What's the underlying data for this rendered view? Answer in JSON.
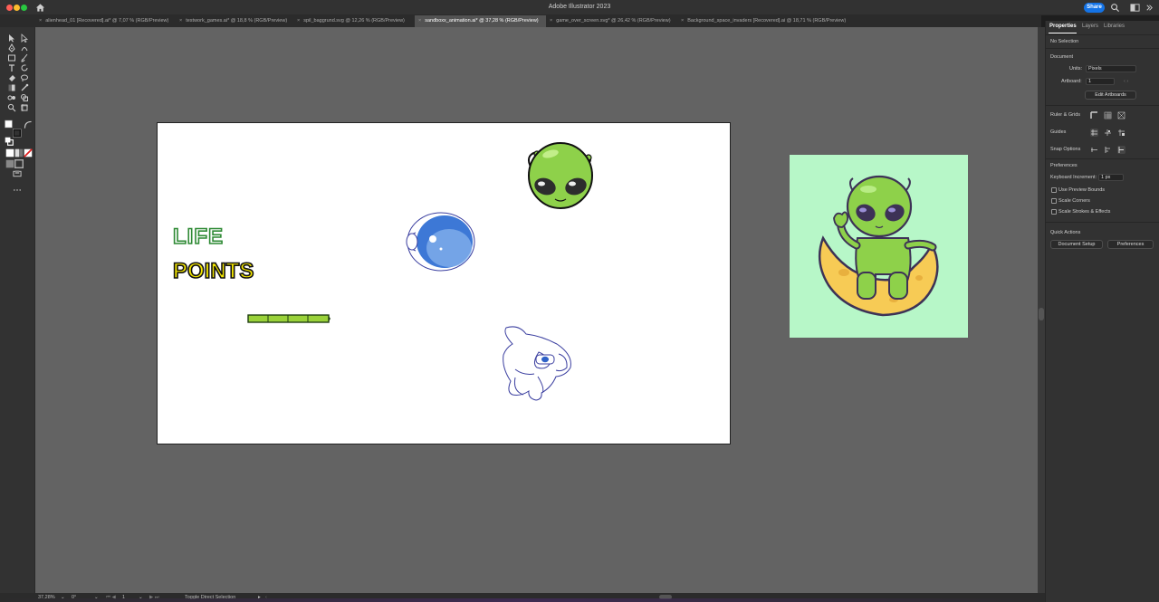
{
  "window": {
    "title": "Adobe Illustrator 2023",
    "share_label": "Share"
  },
  "tabs": [
    {
      "label": "alienhead_01 [Recovered].ai* @ 7,07 % (RGB/Preview)",
      "active": false
    },
    {
      "label": "testwork_games.ai* @ 18,8 % (RGB/Preview)",
      "active": false
    },
    {
      "label": "spil_baggrund.svg @ 12,26 % (RGB/Preview)",
      "active": false
    },
    {
      "label": "sandboxx_animation.ai* @ 37,28 % (RGB/Preview)",
      "active": true
    },
    {
      "label": "game_over_screen.svg* @ 26,42 % (RGB/Preview)",
      "active": false
    },
    {
      "label": "Background_space_invaders [Recovered].ai @ 18,71 % (RGB/Preview)",
      "active": false
    }
  ],
  "tab_close_glyph": "×",
  "artwork": {
    "life_text": "LIFE",
    "points_text": "POINTS"
  },
  "panel": {
    "tabs": [
      "Properties",
      "Layers",
      "Libraries"
    ],
    "selection": "No Selection",
    "document_heading": "Document",
    "units_label": "Units:",
    "units_value": "Pixels",
    "artboard_label": "Artboard:",
    "artboard_value": "1",
    "edit_artboards": "Edit Artboards",
    "ruler_grids": "Ruler & Grids",
    "guides": "Guides",
    "snap_options": "Snap Options",
    "preferences_heading": "Preferences",
    "keyboard_increment_label": "Keyboard Increment:",
    "keyboard_increment_value": "1 px",
    "use_preview_bounds": "Use Preview Bounds",
    "scale_corners": "Scale Corners",
    "scale_strokes": "Scale Strokes & Effects",
    "quick_actions": "Quick Actions",
    "document_setup": "Document Setup",
    "preferences_btn": "Preferences"
  },
  "status": {
    "zoom": "37,28%",
    "rotation": "0°",
    "artboard_nav": "1",
    "tool_hint": "Toggle Direct Selection"
  },
  "colors": {
    "accent": "#1473e6",
    "canvas": "#636363",
    "alien_green": "#8ed14a",
    "artboard2_bg": "#b7f7c8"
  }
}
